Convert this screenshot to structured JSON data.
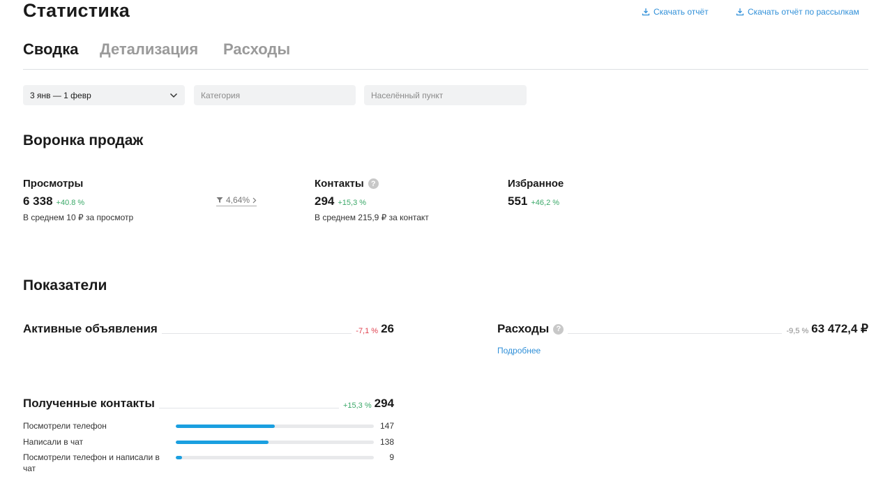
{
  "header": {
    "title": "Статистика",
    "download_report": "Скачать отчёт",
    "download_mailing_report": "Скачать отчёт по рассылкам"
  },
  "tabs": [
    {
      "label": "Сводка",
      "active": true
    },
    {
      "label": "Детализация",
      "active": false
    },
    {
      "label": "Расходы",
      "active": false
    }
  ],
  "filters": {
    "date_range": "3 янв — 1 февр",
    "category_placeholder": "Категория",
    "city_placeholder": "Населённый пункт"
  },
  "funnel": {
    "title": "Воронка продаж",
    "views": {
      "label": "Просмотры",
      "value": "6 338",
      "delta": "+40.8 %",
      "sub": "В среднем 10 ₽ за просмотр"
    },
    "conversion": "4,64%",
    "contacts": {
      "label": "Контакты",
      "value": "294",
      "delta": "+15,3 %",
      "sub": "В среднем 215,9 ₽ за контакт"
    },
    "favorites": {
      "label": "Избранное",
      "value": "551",
      "delta": "+46,2 %"
    }
  },
  "indicators": {
    "title": "Показатели",
    "active_ads": {
      "label": "Активные объявления",
      "delta": "-7,1 %",
      "value": "26"
    },
    "expenses": {
      "label": "Расходы",
      "delta": "-9,5 %",
      "value": "63 472,4 ₽",
      "more": "Подробнее"
    },
    "received_contacts": {
      "label": "Полученные контакты",
      "delta": "+15,3 %",
      "value": "294",
      "rows": [
        {
          "label": "Посмотрели телефон",
          "value": "147",
          "fraction": 0.5
        },
        {
          "label": "Написали в чат",
          "value": "138",
          "fraction": 0.47
        },
        {
          "label": "Посмотрели телефон и написали в чат",
          "value": "9",
          "fraction": 0.03
        }
      ]
    }
  },
  "colors": {
    "accent": "#2f8fd8",
    "positive": "#3aa868",
    "negative": "#e0414f",
    "bar": "#1a9fe0"
  }
}
